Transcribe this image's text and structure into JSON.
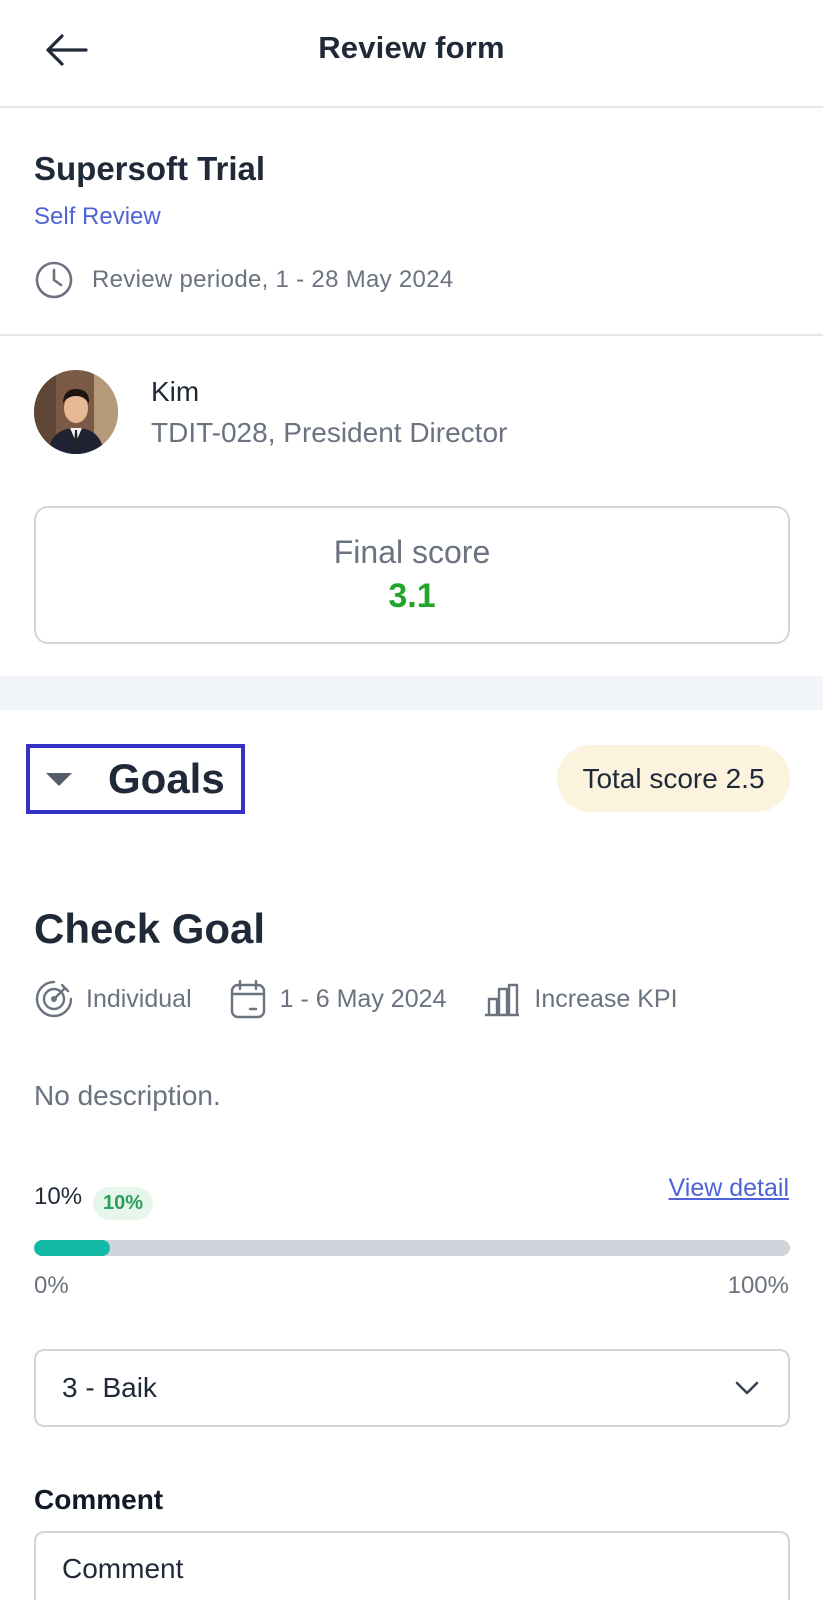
{
  "header": {
    "title": "Review form",
    "back_icon": "arrow-left-icon"
  },
  "review": {
    "title": "Supersoft Trial",
    "type": "Self Review",
    "period": "Review periode, 1 - 28 May 2024",
    "period_icon": "clock-icon"
  },
  "employee": {
    "name": "Kim",
    "role": "TDIT-028, President Director",
    "avatar_icon": "avatar"
  },
  "final_score": {
    "label": "Final score",
    "value": "3.1",
    "color": "#22a52b"
  },
  "goals": {
    "title": "Goals",
    "total_score": "Total score 2.5",
    "expanded": true
  },
  "goal": {
    "title": "Check Goal",
    "type": "Individual",
    "dates": "1 - 6 May 2024",
    "kpi": "Increase KPI",
    "description": "No description.",
    "progress_label": "10%",
    "progress_badge": "10%",
    "progress_fraction": 0.1,
    "view_detail": "View detail",
    "range_min": "0%",
    "range_max": "100%",
    "rating": "3 - Baik",
    "comment_label": "Comment",
    "comment_placeholder": "Comment"
  },
  "colors": {
    "accent": "#4f63d9",
    "progress": "#14b8a6",
    "highlight": "#3333c2",
    "badge_bg": "#fcf3df"
  }
}
